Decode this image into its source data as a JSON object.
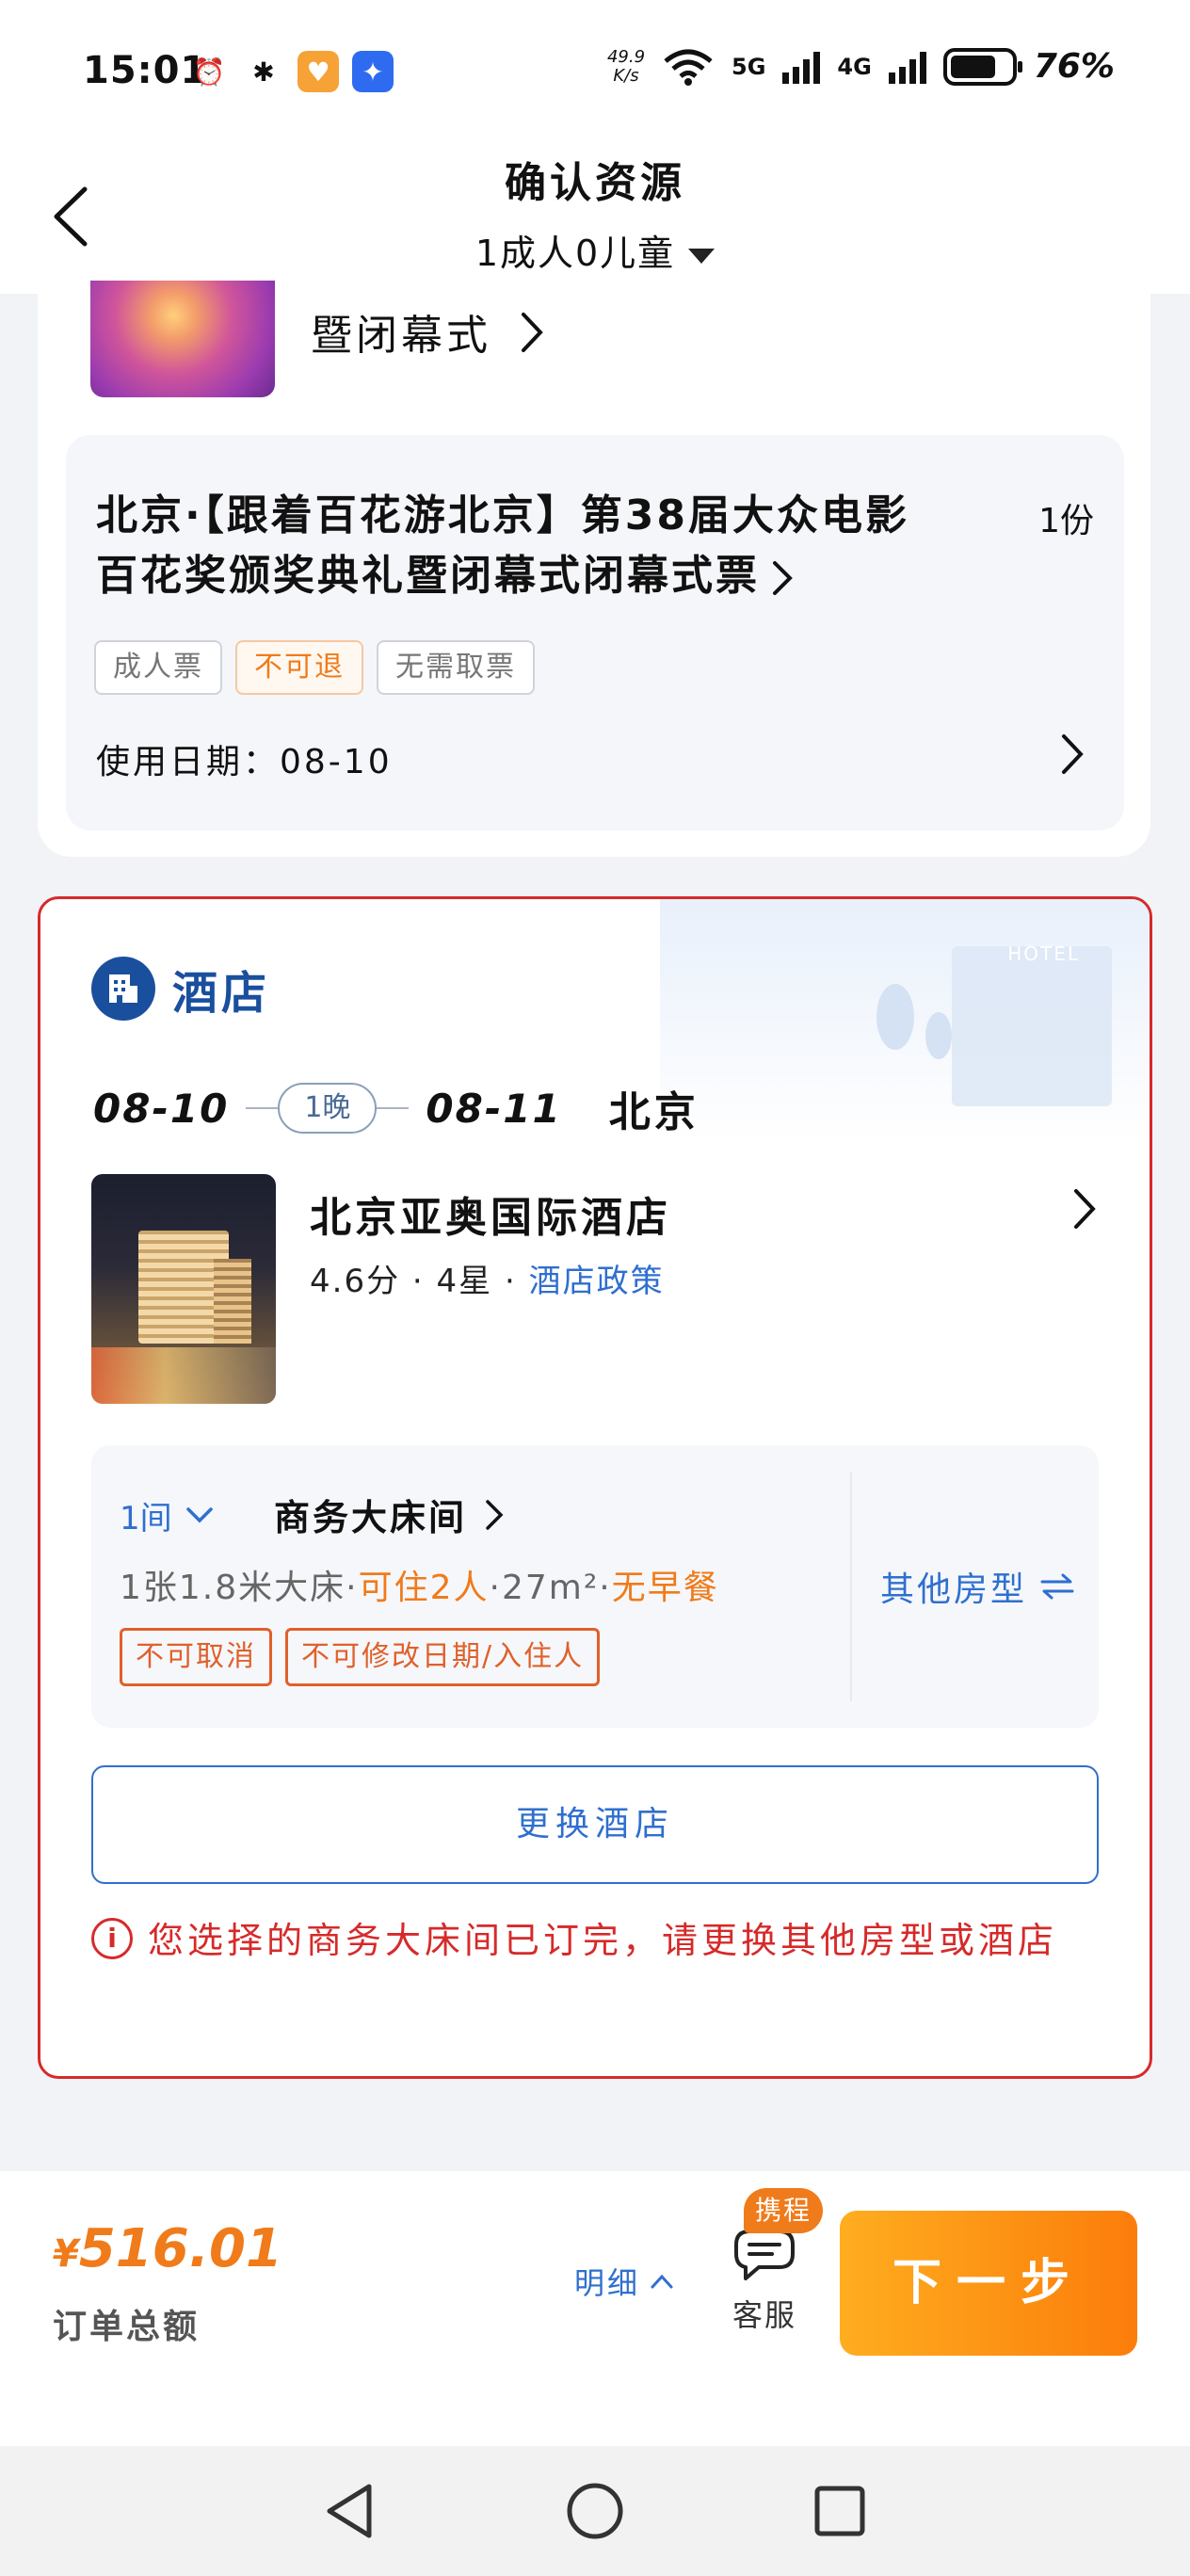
{
  "status_bar": {
    "time": "15:01",
    "net_speed_value": "49.9",
    "net_speed_unit": "K/s",
    "signal1": "5G",
    "signal2": "4G",
    "battery": "76%",
    "icons": [
      "alarm-icon",
      "bluetooth-icon",
      "health-app-icon",
      "app-store-icon",
      "wifi-icon"
    ]
  },
  "header": {
    "title": "确认资源",
    "subtitle": "1成人0儿童"
  },
  "event_card": {
    "cut_title": "暨闭幕式",
    "ticket_title": "北京·【跟着百花游北京】第38届大众电影百花奖颁奖典礼暨闭幕式闭幕式票",
    "qty": "1份",
    "tags": [
      "成人票",
      "不可退",
      "无需取票"
    ],
    "use_date": "使用日期：08-10"
  },
  "hotel": {
    "section_label": "酒店",
    "deco_label": "HOTEL",
    "check_in": "08-10",
    "nights": "1晚",
    "check_out": "08-11",
    "city": "北京",
    "name": "北京亚奥国际酒店",
    "score": "4.6分",
    "stars": "4星",
    "policy": "酒店政策",
    "room": {
      "count": "1间",
      "type": "商务大床间",
      "bed": "1张1.8米大床",
      "capacity": "可住2人",
      "area": "27m²",
      "breakfast": "无早餐",
      "tags": [
        "不可取消",
        "不可修改日期/入住人"
      ],
      "other_label": "其他房型"
    },
    "change_button": "更换酒店",
    "warning": "您选择的商务大床间已订完，请更换其他房型或酒店"
  },
  "bottom": {
    "currency": "¥",
    "price": "516.01",
    "total_label": "订单总额",
    "detail_label": "明细",
    "service_badge": "携程",
    "service_label": "客服",
    "next_label": "下一步"
  },
  "colors": {
    "accent_blue": "#2f6fcf",
    "hotel_blue": "#1a4f9e",
    "warning_red": "#d62a2a",
    "orange": "#f07b1a"
  }
}
